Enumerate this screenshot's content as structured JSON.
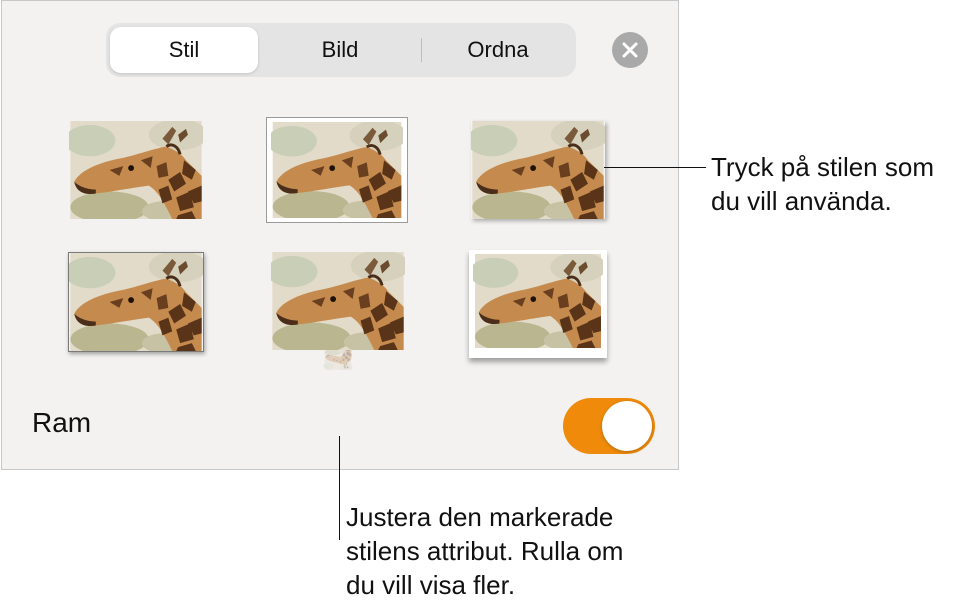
{
  "tabs": [
    {
      "label": "Stil",
      "active": true
    },
    {
      "label": "Bild",
      "active": false
    },
    {
      "label": "Ordna",
      "active": false
    }
  ],
  "close_icon": "close-icon",
  "styles": [
    {
      "name": "style-1",
      "selected": false
    },
    {
      "name": "style-2",
      "selected": true
    },
    {
      "name": "style-3",
      "selected": false
    },
    {
      "name": "style-4",
      "selected": false
    },
    {
      "name": "style-5",
      "selected": false
    },
    {
      "name": "style-6",
      "selected": false
    }
  ],
  "border": {
    "label": "Ram",
    "enabled": true,
    "accent": "#ef8a0b"
  },
  "callouts": {
    "style_line1": "Tryck på stilen som",
    "style_line2": "du vill använda.",
    "adjust_line1": "Justera den markerade",
    "adjust_line2": "stilens attribut. Rulla om",
    "adjust_line3": "du vill visa fler."
  }
}
